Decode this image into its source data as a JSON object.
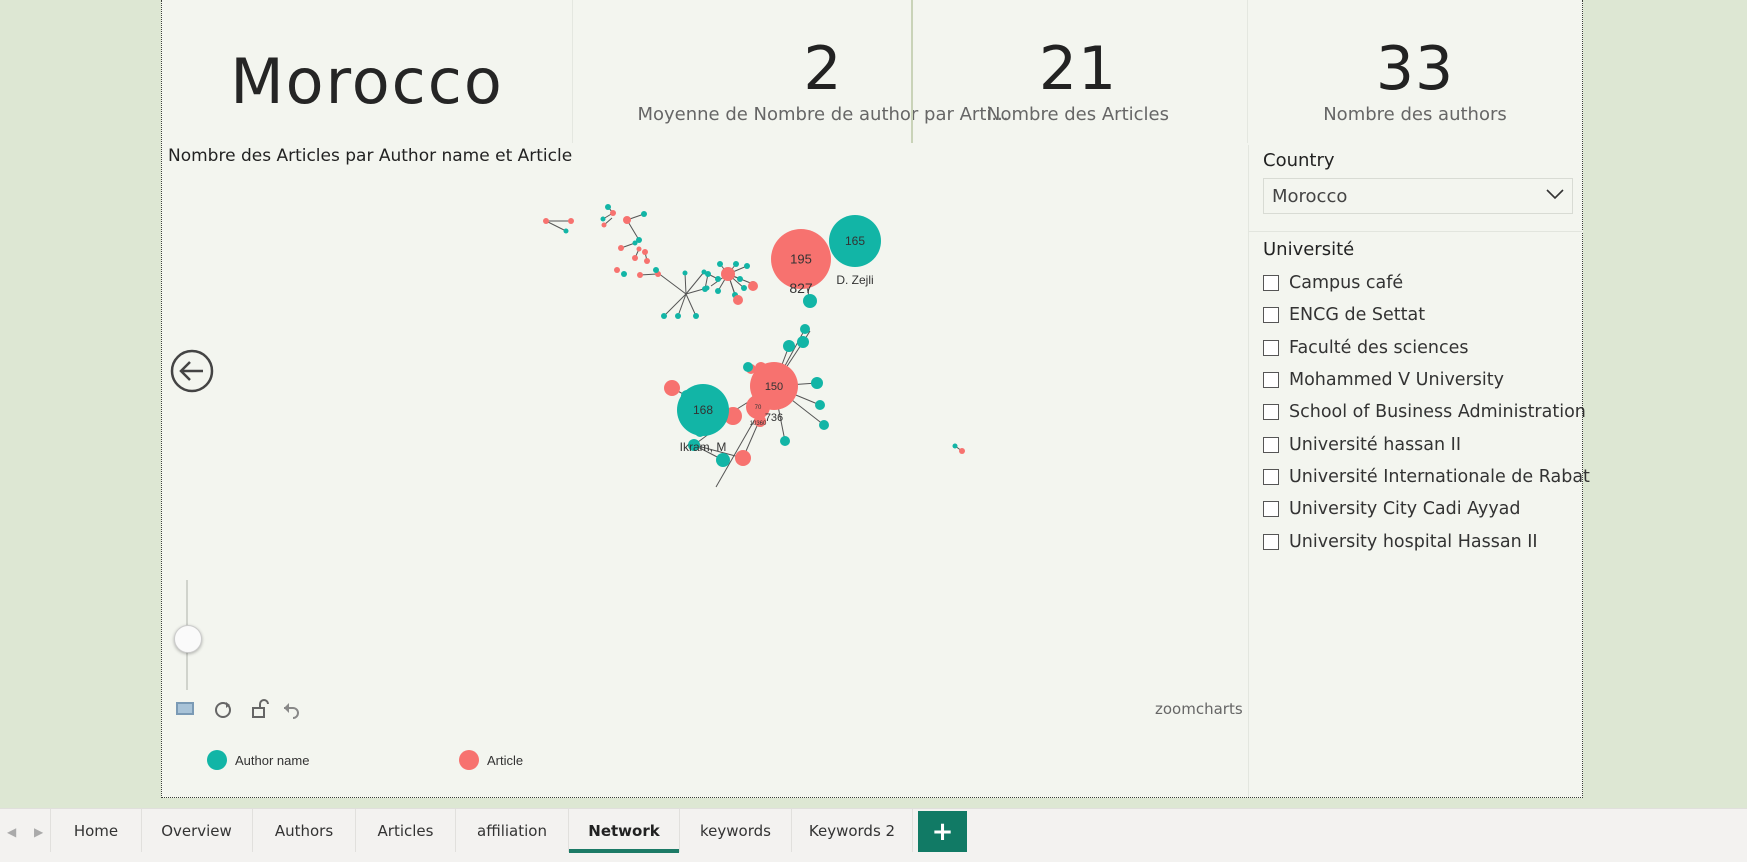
{
  "cards": {
    "country": "Morocco",
    "avg_authors_value": "2",
    "avg_authors_label": "Moyenne de Nombre de author par Arti...",
    "articles_value": "21",
    "articles_label": "Nombre des Articles",
    "authors_value": "33",
    "authors_label": "Nombre des authors"
  },
  "network": {
    "title": "Nombre des Articles par Author name et Article",
    "legend": {
      "author": "Author name",
      "article": "Article"
    },
    "watermark": "zoomcharts",
    "nodes": [
      {
        "label": "195",
        "caption": "827"
      },
      {
        "label": "165",
        "caption": "D. Zejli"
      },
      {
        "label": "150",
        "caption": "736"
      },
      {
        "label": "168",
        "caption": "Ikram, M"
      },
      {
        "label": "70",
        "caption": "10360"
      }
    ],
    "colors": {
      "author": "#12b5a6",
      "article": "#f7726f"
    }
  },
  "slicer": {
    "country_header": "Country",
    "country_value": "Morocco",
    "university_header": "Université",
    "universities": [
      "Campus café",
      "ENCG de Settat",
      "Faculté des sciences",
      "Mohammed V University",
      "School of Business Administration",
      "Université hassan II",
      "Université Internationale de Rabat",
      "University City Cadi Ayyad",
      "University hospital Hassan II"
    ]
  },
  "tabs": [
    "Home",
    "Overview",
    "Authors",
    "Articles",
    "affiliation",
    "Network",
    "keywords",
    "Keywords 2"
  ],
  "active_tab": "Network"
}
